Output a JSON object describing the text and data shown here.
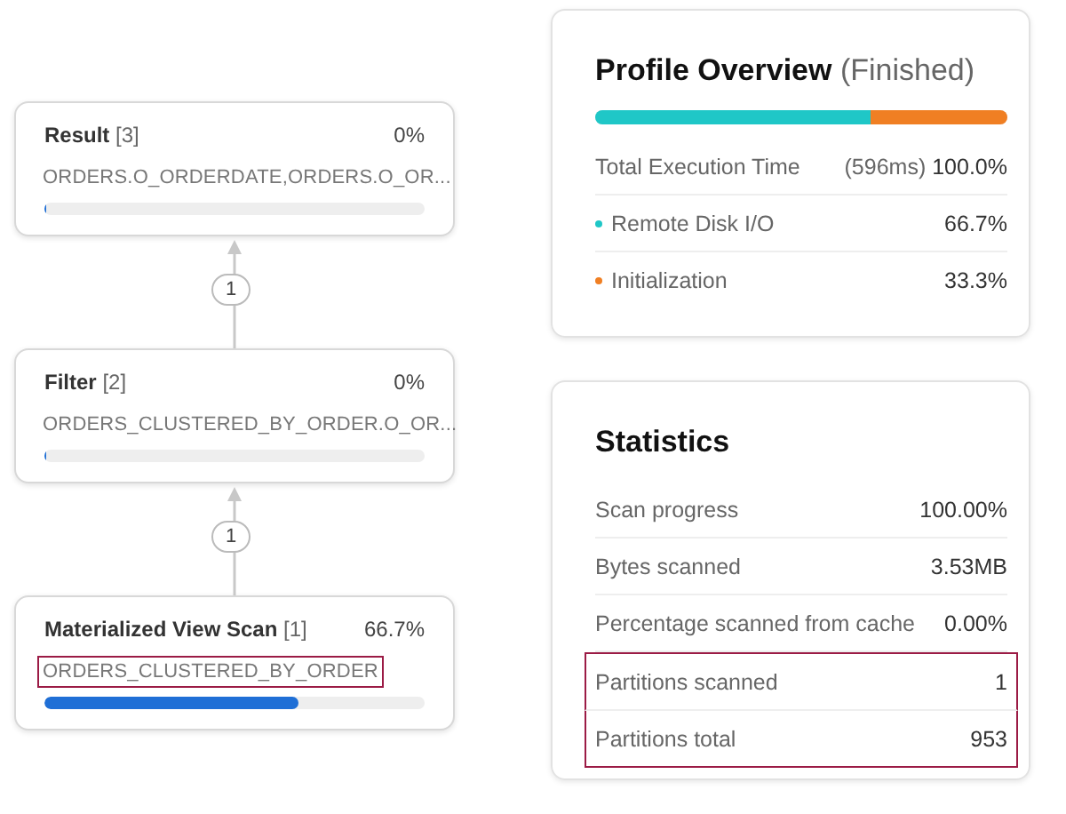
{
  "plan": {
    "nodes": [
      {
        "title": "Result",
        "index": "[3]",
        "percent": "0%",
        "detail": "ORDERS.O_ORDERDATE,ORDERS.O_OR...",
        "level": 0,
        "highlighted": false
      },
      {
        "title": "Filter",
        "index": "[2]",
        "percent": "0%",
        "detail": "ORDERS_CLUSTERED_BY_ORDER.O_OR...",
        "level": 0,
        "highlighted": false
      },
      {
        "title": "Materialized View Scan",
        "index": "[1]",
        "percent": "66.7%",
        "detail": "ORDERS_CLUSTERED_BY_ORDER",
        "level": 0.667,
        "highlighted": true
      }
    ],
    "edges": [
      {
        "label": "1"
      },
      {
        "label": "1"
      }
    ]
  },
  "overview": {
    "title": "Profile Overview",
    "status": "(Finished)",
    "total": {
      "label": "Total Execution Time",
      "duration": "(596ms)",
      "value": "100.0%"
    },
    "breakdown": [
      {
        "label": "Remote Disk I/O",
        "value": "66.7%",
        "level": 0.667,
        "color": "#1fc7c7"
      },
      {
        "label": "Initialization",
        "value": "33.3%",
        "level": 0.333,
        "color": "#f07f23"
      }
    ]
  },
  "statistics": {
    "title": "Statistics",
    "rows": [
      {
        "label": "Scan progress",
        "value": "100.00%",
        "highlighted": false
      },
      {
        "label": "Bytes scanned",
        "value": "3.53MB",
        "highlighted": false
      },
      {
        "label": "Percentage scanned from cache",
        "value": "0.00%",
        "highlighted": false
      },
      {
        "label": "Partitions scanned",
        "value": "1",
        "highlighted": true
      },
      {
        "label": "Partitions total",
        "value": "953",
        "highlighted": true
      }
    ]
  }
}
